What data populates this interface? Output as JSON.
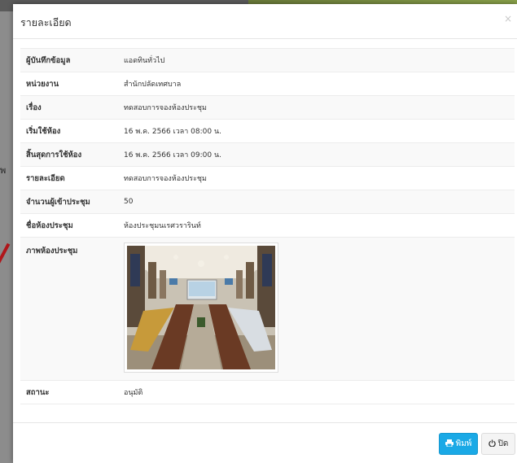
{
  "background": {
    "side_text": "พ"
  },
  "modal": {
    "title": "รายละเอียด",
    "close_glyph": "×",
    "rows": [
      {
        "label": "ผู้บันทึกข้อมูล",
        "value": "แอดทินทั่วไป"
      },
      {
        "label": "หน่วยงาน",
        "value": "สำนักปลัดเทศบาล"
      },
      {
        "label": "เรื่อง",
        "value": "ทดสอบการจองห้องประชุม"
      },
      {
        "label": "เริ่มใช้ห้อง",
        "value": "16 พ.ค. 2566 เวลา 08:00 น."
      },
      {
        "label": "สิ้นสุดการใช้ห้อง",
        "value": "16 พ.ค. 2566 เวลา 09:00 น."
      },
      {
        "label": "รายละเอียด",
        "value": "ทดสอบการจองห้องประชุม"
      },
      {
        "label": "จำนวนผู้เข้าประชุม",
        "value": "50"
      },
      {
        "label": "ชื่อห้องประชุม",
        "value": "ห้องประชุมนเรศวรารินท์"
      }
    ],
    "photo_label": "ภาพห้องประชุม",
    "status_label": "สถานะ",
    "status_value": "อนุมัติ"
  },
  "footer": {
    "print_label": "พิมพ์",
    "close_label": "ปิด"
  },
  "icons": {
    "print": "print-icon",
    "power": "power-icon"
  }
}
